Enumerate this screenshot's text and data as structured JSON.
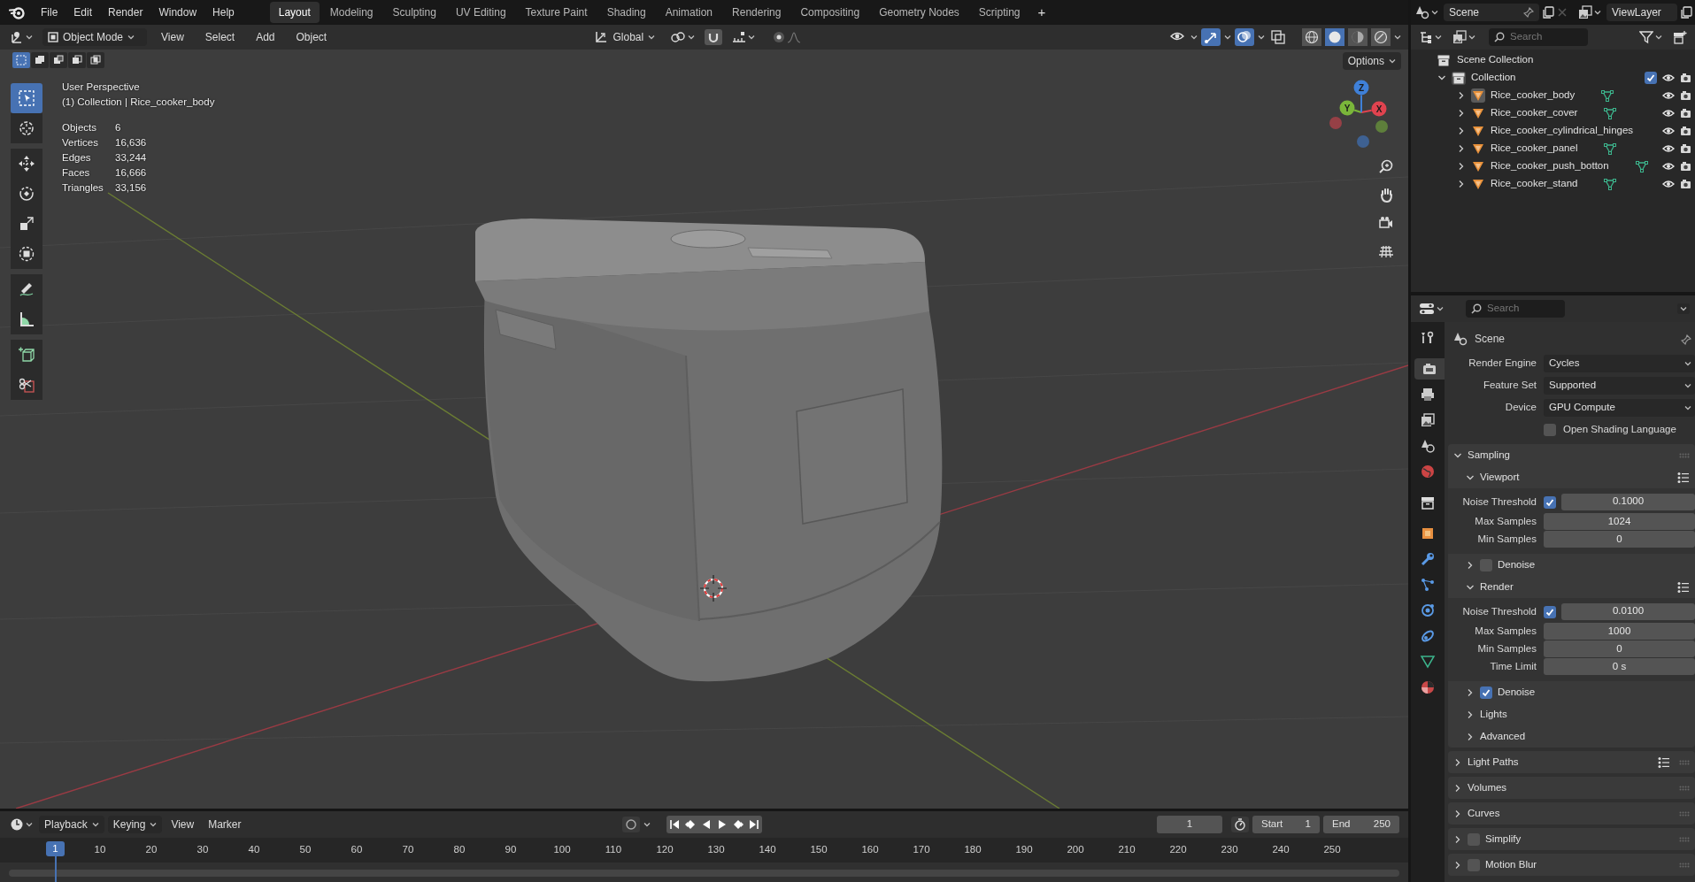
{
  "menu": [
    "File",
    "Edit",
    "Render",
    "Window",
    "Help"
  ],
  "workspaces": [
    {
      "label": "Layout",
      "selected": true
    },
    {
      "label": "Modeling",
      "selected": false
    },
    {
      "label": "Sculpting",
      "selected": false
    },
    {
      "label": "UV Editing",
      "selected": false
    },
    {
      "label": "Texture Paint",
      "selected": false
    },
    {
      "label": "Shading",
      "selected": false
    },
    {
      "label": "Animation",
      "selected": false
    },
    {
      "label": "Rendering",
      "selected": false
    },
    {
      "label": "Compositing",
      "selected": false
    },
    {
      "label": "Geometry Nodes",
      "selected": false
    },
    {
      "label": "Scripting",
      "selected": false
    }
  ],
  "add_workspace": "+",
  "scene": "Scene",
  "view_layer": "ViewLayer",
  "viewport_header": {
    "mode": "Object Mode",
    "menus": [
      "View",
      "Select",
      "Add",
      "Object"
    ],
    "orientation": "Global"
  },
  "toggles": [
    {
      "kind": "visibility",
      "on": false
    },
    {
      "kind": "gizmos",
      "on": true
    },
    {
      "kind": "overlays",
      "on": true
    },
    {
      "kind": "xray",
      "on": false
    }
  ],
  "shading_modes": [
    {
      "kind": "wireframe",
      "selected": false
    },
    {
      "kind": "solid",
      "selected": true
    },
    {
      "kind": "material",
      "selected": false
    },
    {
      "kind": "rendered",
      "selected": false
    }
  ],
  "select_modes": [
    {
      "kind": "set",
      "selected": true
    },
    {
      "kind": "extend",
      "selected": false
    },
    {
      "kind": "subtract",
      "selected": false
    },
    {
      "kind": "invert",
      "selected": false
    },
    {
      "kind": "intersect",
      "selected": false
    }
  ],
  "options": "Options",
  "viewport": {
    "title": "User Perspective",
    "context": "(1) Collection | Rice_cooker_body",
    "stats": [
      {
        "label": "Objects",
        "value": "6"
      },
      {
        "label": "Vertices",
        "value": "16,636"
      },
      {
        "label": "Edges",
        "value": "33,244"
      },
      {
        "label": "Faces",
        "value": "16,666"
      },
      {
        "label": "Triangles",
        "value": "33,156"
      }
    ]
  },
  "tools": [
    {
      "kind": "select_box",
      "selected": true
    },
    {
      "kind": "cursor",
      "selected": false
    },
    {
      "kind": "move",
      "selected": false
    },
    {
      "kind": "rotate",
      "selected": false
    },
    {
      "kind": "scale",
      "selected": false
    },
    {
      "kind": "transform",
      "selected": false
    },
    {
      "kind": "annotate",
      "selected": false
    },
    {
      "kind": "measure",
      "selected": false
    },
    {
      "kind": "add_cube",
      "selected": false
    },
    {
      "kind": "knife",
      "selected": false
    }
  ],
  "gizmo_axes": [
    {
      "label": "X",
      "color": "#e0434f"
    },
    {
      "label": "Y",
      "color": "#7ab63a"
    },
    {
      "label": "Z",
      "color": "#3f80d8"
    }
  ],
  "outliner": {
    "search_placeholder": "Search",
    "root": "Scene Collection",
    "collection": {
      "label": "Collection",
      "expanded": true,
      "checked": true
    },
    "objects": [
      {
        "label": "Rice_cooker_body",
        "selected": true,
        "mesh_data": true
      },
      {
        "label": "Rice_cooker_cover",
        "selected": false,
        "mesh_data": true
      },
      {
        "label": "Rice_cooker_cylindrical_hinges",
        "selected": false,
        "mesh_data": false
      },
      {
        "label": "Rice_cooker_panel",
        "selected": false,
        "mesh_data": true
      },
      {
        "label": "Rice_cooker_push_botton",
        "selected": false,
        "mesh_data": true
      },
      {
        "label": "Rice_cooker_stand",
        "selected": false,
        "mesh_data": true
      }
    ]
  },
  "properties": {
    "search_placeholder": "Search",
    "tabs": [
      {
        "kind": "tool",
        "selected": false
      },
      {
        "kind": "render",
        "selected": true
      },
      {
        "kind": "output",
        "selected": false
      },
      {
        "kind": "view_layer",
        "selected": false
      },
      {
        "kind": "scene",
        "selected": false
      },
      {
        "kind": "world",
        "selected": false
      },
      {
        "kind": "collection",
        "selected": false
      },
      {
        "kind": "object",
        "selected": false
      },
      {
        "kind": "modifiers",
        "selected": false
      },
      {
        "kind": "particles",
        "selected": false
      },
      {
        "kind": "physics",
        "selected": false
      },
      {
        "kind": "constraints",
        "selected": false
      },
      {
        "kind": "data",
        "selected": false
      },
      {
        "kind": "material",
        "selected": false
      }
    ],
    "context": "Scene",
    "fields": [
      {
        "label": "Render Engine",
        "value": "Cycles"
      },
      {
        "label": "Feature Set",
        "value": "Supported"
      },
      {
        "label": "Device",
        "value": "GPU Compute"
      }
    ],
    "osl": {
      "label": "Open Shading Language",
      "checked": false
    },
    "panels": [
      {
        "label": "Sampling",
        "expanded": true,
        "subpanels": [
          {
            "label": "Viewport",
            "expanded": true,
            "presets": true,
            "rows": [
              {
                "label": "Noise Threshold",
                "checked": true,
                "value": "0.1000"
              },
              {
                "label": "Max Samples",
                "value": "1024"
              },
              {
                "label": "Min Samples",
                "value": "0"
              }
            ]
          },
          {
            "label": "Denoise",
            "expanded": false,
            "checked": false
          },
          {
            "label": "Render",
            "expanded": true,
            "presets": true,
            "rows": [
              {
                "label": "Noise Threshold",
                "checked": true,
                "value": "0.0100"
              },
              {
                "label": "Max Samples",
                "value": "1000"
              },
              {
                "label": "Min Samples",
                "value": "0"
              },
              {
                "label": "Time Limit",
                "value": "0 s"
              }
            ]
          },
          {
            "label": "Denoise",
            "expanded": false,
            "checked": true
          },
          {
            "label": "Lights",
            "expanded": false
          },
          {
            "label": "Advanced",
            "expanded": false
          }
        ]
      },
      {
        "label": "Light Paths",
        "expanded": false,
        "presets": true
      },
      {
        "label": "Volumes",
        "expanded": false
      },
      {
        "label": "Curves",
        "expanded": false
      },
      {
        "label": "Simplify",
        "expanded": false,
        "checked": false
      },
      {
        "label": "Motion Blur",
        "expanded": false,
        "checked": false
      }
    ]
  },
  "timeline": {
    "menus": [
      {
        "label": "Playback",
        "dropdown": true
      },
      {
        "label": "Keying",
        "dropdown": true
      },
      {
        "label": "View",
        "dropdown": false
      },
      {
        "label": "Marker",
        "dropdown": false
      }
    ],
    "current_frame": "1",
    "start_label": "Start",
    "start": "1",
    "end_label": "End",
    "end": "250",
    "playhead": "1",
    "ruler": [
      "10",
      "20",
      "30",
      "40",
      "50",
      "60",
      "70",
      "80",
      "90",
      "100",
      "110",
      "120",
      "130",
      "140",
      "150",
      "160",
      "170",
      "180",
      "190",
      "200",
      "210",
      "220",
      "230",
      "240",
      "250"
    ]
  }
}
